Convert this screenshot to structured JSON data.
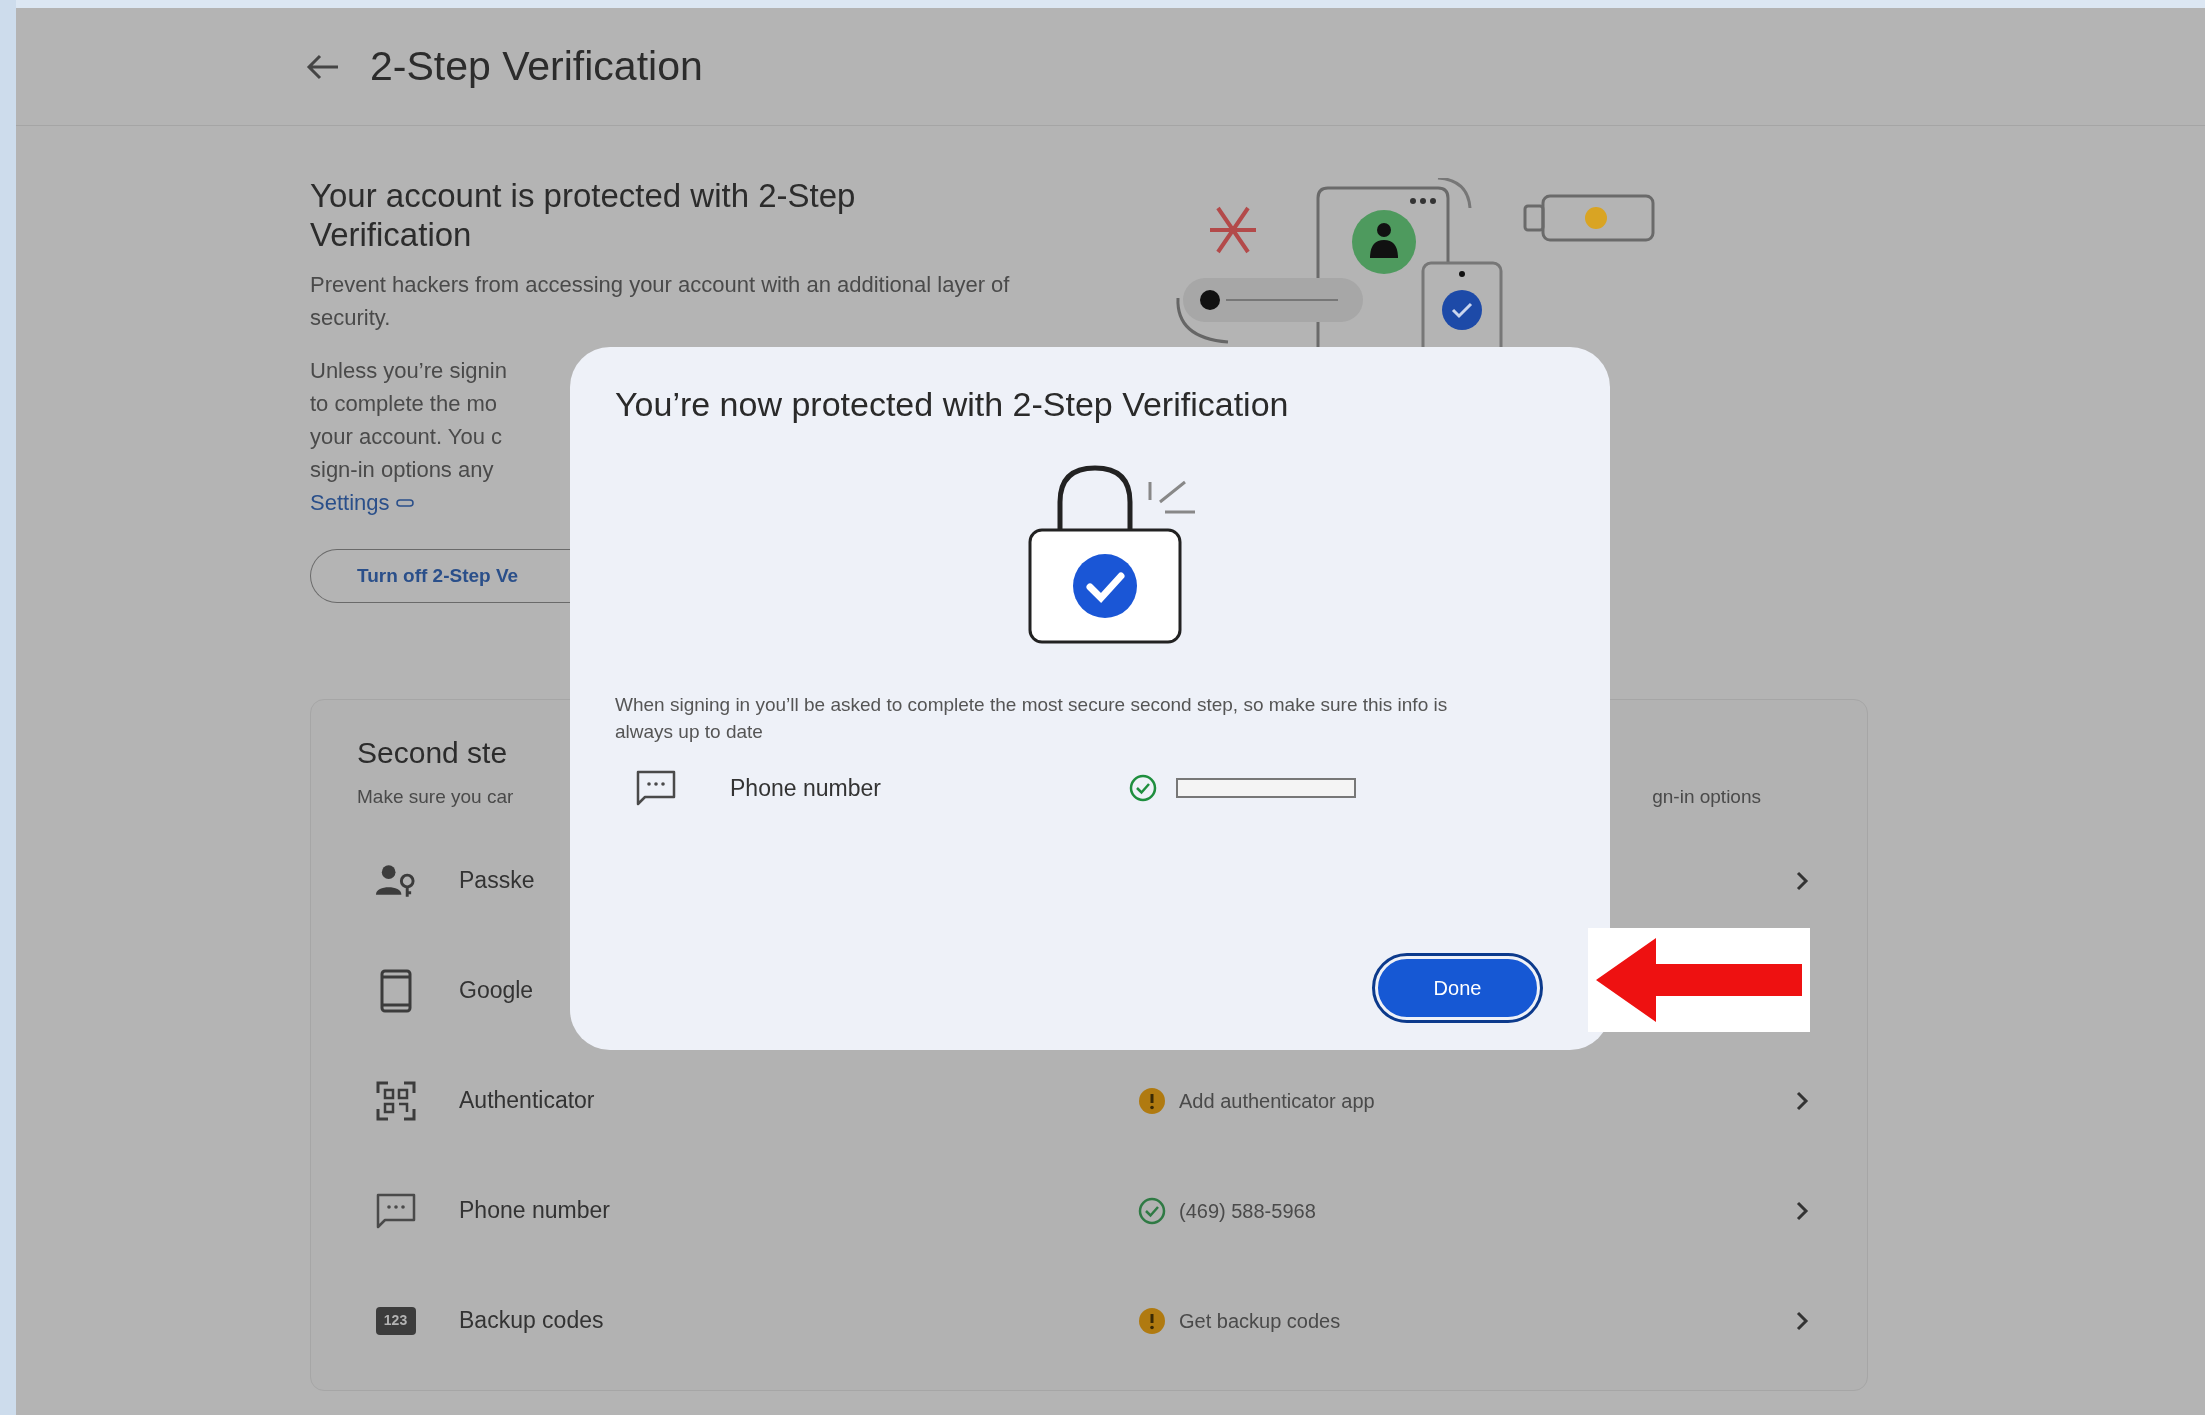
{
  "header": {
    "title": "2-Step Verification"
  },
  "intro": {
    "heading": "Your account is protected with 2-Step Verification",
    "description": "Prevent hackers from accessing your account with an additional layer of security.",
    "details_lines": [
      "Unless you’re signin",
      "to complete the mo",
      "your account. You c",
      "sign-in options any"
    ],
    "settings_link": "Settings",
    "turn_off_button": "Turn off 2-Step Ve"
  },
  "second_steps": {
    "title": "Second ste",
    "subtitle_left": "Make sure you car",
    "subtitle_right": "gn-in options",
    "rows": [
      {
        "kind": "passkey",
        "label": "Passke",
        "chevron": true
      },
      {
        "kind": "device",
        "label": "Google",
        "chevron": false
      },
      {
        "kind": "authenticator",
        "label": "Authenticator",
        "status": {
          "kind": "warning",
          "text": "Add authenticator app"
        },
        "chevron": true
      },
      {
        "kind": "phone",
        "label": "Phone number",
        "status": {
          "kind": "ok",
          "text": "(469) 588-5968"
        },
        "chevron": true
      },
      {
        "kind": "backup_codes",
        "label": "Backup codes",
        "icon_text": "123",
        "status": {
          "kind": "warning",
          "text": "Get backup codes"
        },
        "chevron": true
      }
    ]
  },
  "dialog": {
    "title": "You’re now protected with 2-Step Verification",
    "message": "When signing in you’ll be asked to complete the most secure second step, so make sure this info is always up to date",
    "item": {
      "label": "Phone number",
      "verified": true
    },
    "done_button": "Done"
  }
}
